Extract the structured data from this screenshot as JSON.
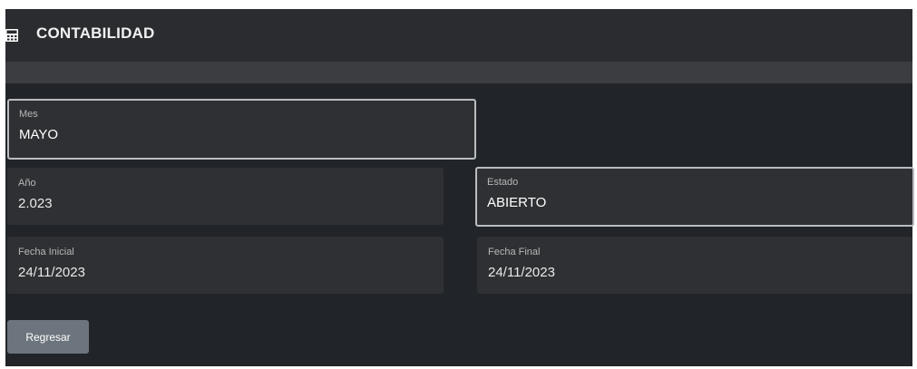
{
  "header": {
    "title": "CONTABILIDAD",
    "icon": "calculator-icon"
  },
  "fields": {
    "mes": {
      "label": "Mes",
      "value": "MAYO"
    },
    "anio": {
      "label": "Año",
      "value": "2.023"
    },
    "estado": {
      "label": "Estado",
      "value": "ABIERTO"
    },
    "fecha_inicial": {
      "label": "Fecha Inicial",
      "value": "24/11/2023"
    },
    "fecha_final": {
      "label": "Fecha Final",
      "value": "24/11/2023"
    }
  },
  "actions": {
    "back_label": "Regresar"
  },
  "colors": {
    "background": "#212529",
    "header": "#2b2c2f",
    "field": "#2f3033",
    "button": "#6c757d"
  }
}
